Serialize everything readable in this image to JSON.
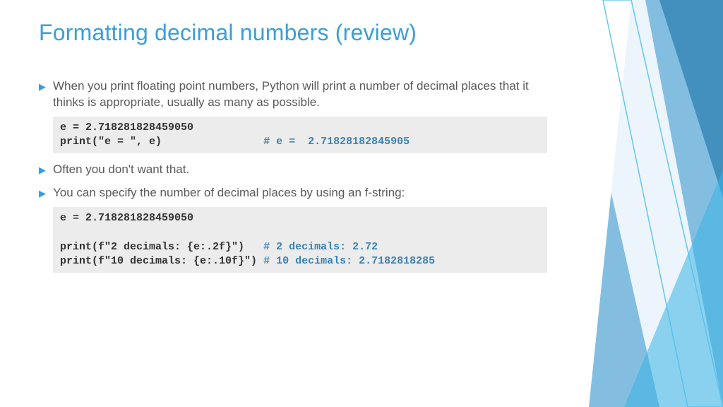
{
  "title": "Formatting decimal numbers (review)",
  "bullets": {
    "b1": "When you print floating point numbers, Python will print a number of decimal places that it thinks is appropriate, usually as many as possible.",
    "b2": "Often you don't want that.",
    "b3": "You can specify the number of decimal places by using an f-string:"
  },
  "code1": {
    "l1": "e = 2.718281828459050",
    "l2a": "print(\"e = \", e)",
    "l2pad": "                ",
    "l2c": "# e =  2.71828182845905"
  },
  "code2": {
    "l1": "e = 2.718281828459050",
    "blank": " ",
    "l3a": "print(f\"2 decimals: {e:.2f}\")",
    "l3pad": "   ",
    "l3c": "# 2 decimals: 2.72",
    "l4a": "print(f\"10 decimals: {e:.10f}\")",
    "l4pad": " ",
    "l4c": "# 10 decimals: 2.7182818285"
  }
}
